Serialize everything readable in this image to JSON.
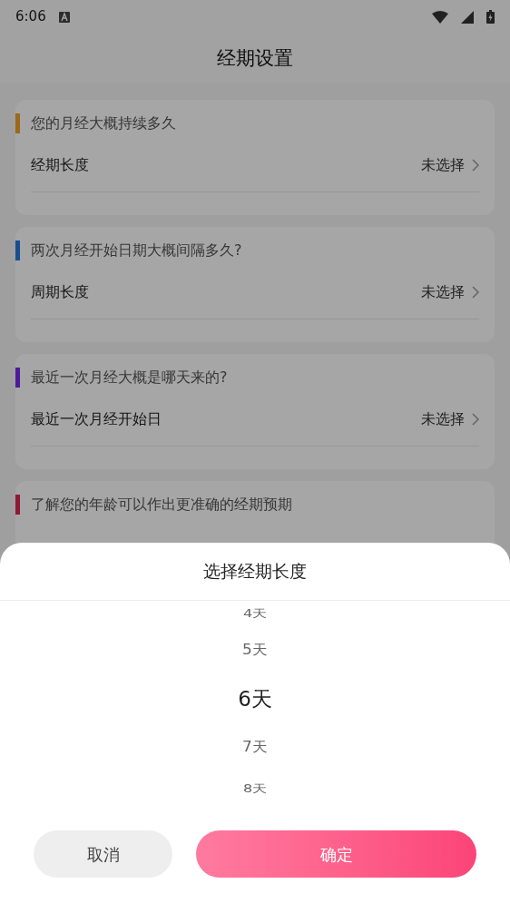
{
  "status_bar": {
    "time": "6:06"
  },
  "header": {
    "title": "经期设置"
  },
  "sections": [
    {
      "question": "您的月经大概持续多久",
      "color": "#9c681a",
      "label": "经期长度",
      "value": "未选择"
    },
    {
      "question": "两次月经开始日期大概间隔多久?",
      "color": "#1a4e8f",
      "label": "周期长度",
      "value": "未选择"
    },
    {
      "question": "最近一次月经大概是哪天来的?",
      "color": "#4e1a9c",
      "label": "最近一次月经开始日",
      "value": "未选择"
    },
    {
      "question": "了解您的年龄可以作出更准确的经期预期",
      "color": "#8f1a34"
    }
  ],
  "sheet": {
    "title": "选择经期长度",
    "options": [
      {
        "label": "4天",
        "selected": false
      },
      {
        "label": "5天",
        "selected": false
      },
      {
        "label": "6天",
        "selected": true
      },
      {
        "label": "7天",
        "selected": false
      },
      {
        "label": "8天",
        "selected": false
      }
    ],
    "cancel": "取消",
    "confirm": "确定"
  }
}
